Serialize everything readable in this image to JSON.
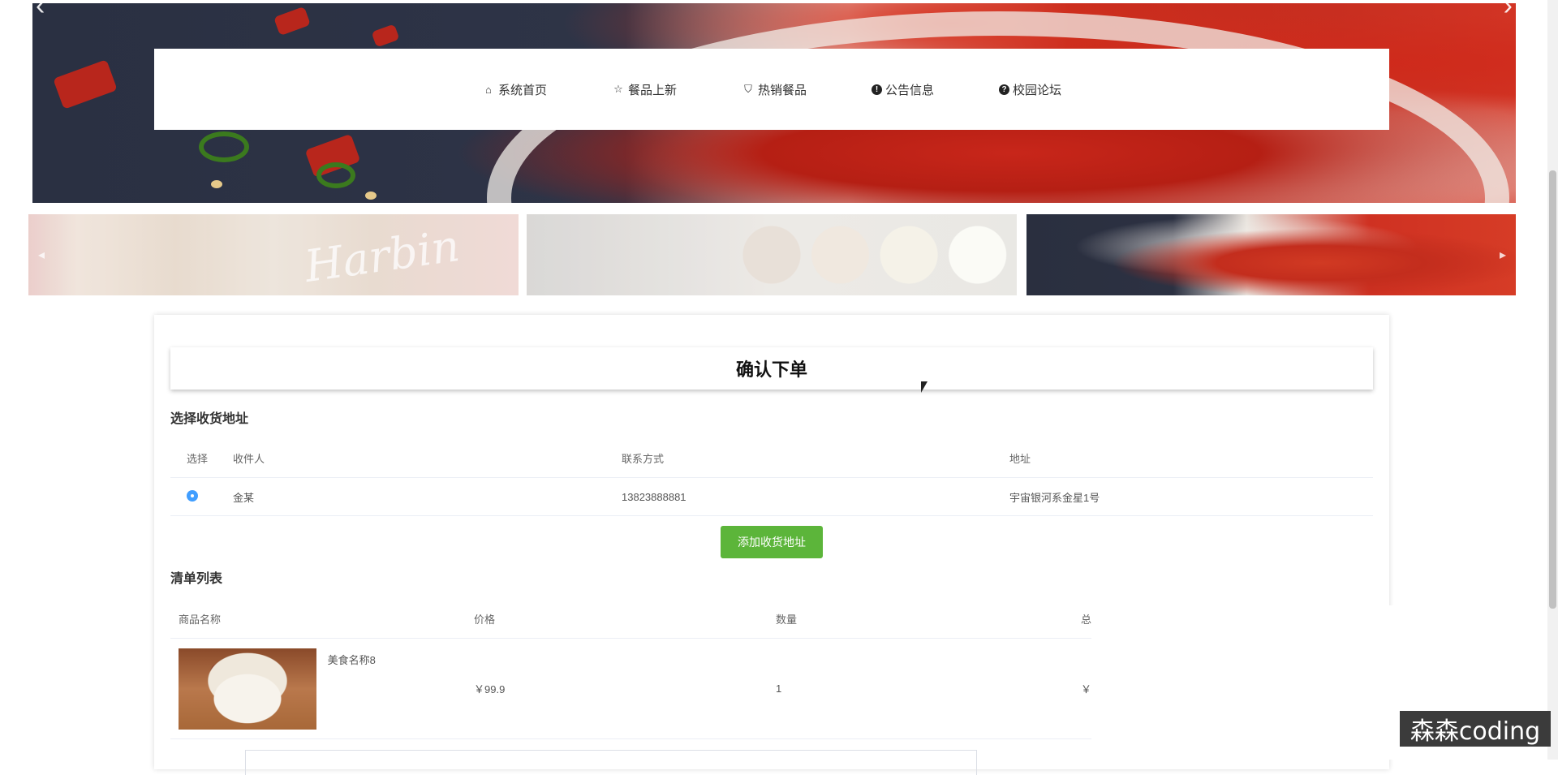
{
  "nav": {
    "items": [
      {
        "icon": "home-icon",
        "glyph": "⌂",
        "label": "系统首页"
      },
      {
        "icon": "star-icon",
        "glyph": "☆",
        "label": "餐品上新"
      },
      {
        "icon": "shopping-bag-icon",
        "glyph": "⛉",
        "label": "热销餐品"
      },
      {
        "icon": "info-circle-icon",
        "glyph": "!",
        "label": "公告信息"
      },
      {
        "icon": "question-circle-icon",
        "glyph": "?",
        "label": "校园论坛"
      }
    ]
  },
  "thumbs": {
    "script_text": "Harbin"
  },
  "order": {
    "title": "确认下单",
    "address_section": "选择收货地址",
    "address_headers": {
      "select": "选择",
      "name": "收件人",
      "phone": "联系方式",
      "address": "地址"
    },
    "address_rows": [
      {
        "selected": true,
        "name": "金某",
        "phone": "13823888881",
        "address": "宇宙银河系金星1号"
      }
    ],
    "add_address_button": "添加收货地址",
    "list_section": "清单列表",
    "list_headers": {
      "product": "商品名称",
      "price": "价格",
      "quantity": "数量",
      "total": "总"
    },
    "items": [
      {
        "name": "美食名称8",
        "price": "￥99.9",
        "quantity": "1",
        "total": "￥"
      }
    ]
  },
  "watermark": "森森coding",
  "colors": {
    "primary": "#409eff",
    "add_button": "#5cb53a"
  }
}
